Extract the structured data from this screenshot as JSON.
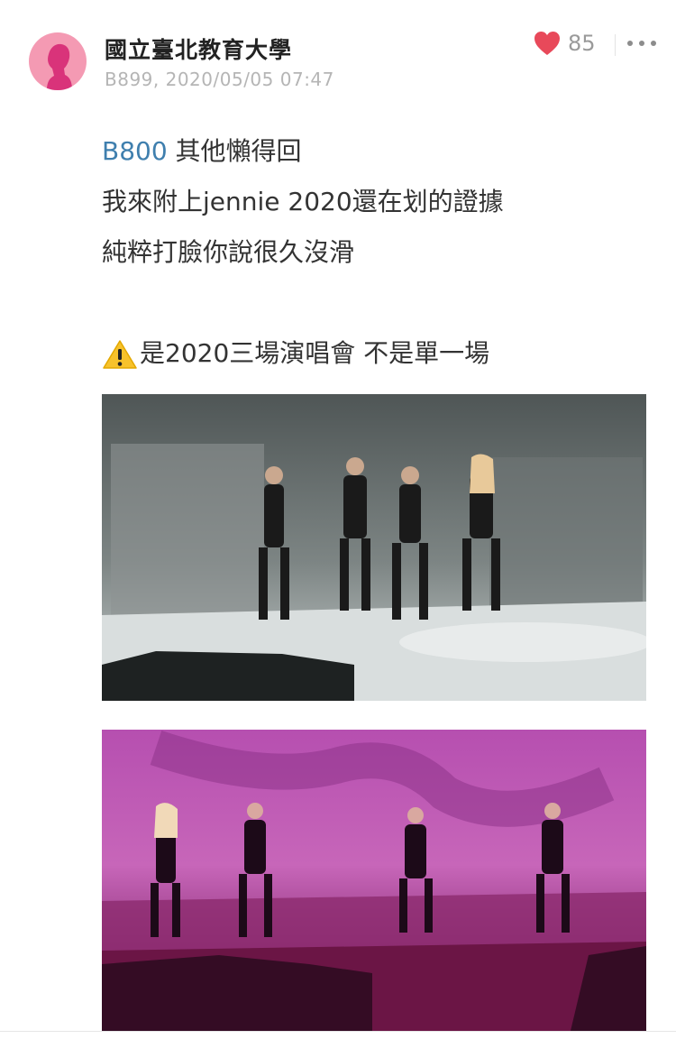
{
  "post": {
    "author": "國立臺北教育大學",
    "floor_and_time": "B899, 2020/05/05 07:47",
    "like_count": "85",
    "reply_target": "B800",
    "line1_rest": " 其他懶得回",
    "line2": "我來附上jennie 2020還在划的證據",
    "line3": "純粹打臉你說很久沒滑",
    "line4": "是2020三場演唱會 不是單一場"
  },
  "colors": {
    "avatar_bg": "#f49ab3",
    "heart": "#e8495a",
    "reply_link": "#3f7fae",
    "meta_text": "#b5b5b5"
  },
  "icons": [
    "avatar-icon",
    "heart-icon",
    "more-icon",
    "warning-icon"
  ]
}
